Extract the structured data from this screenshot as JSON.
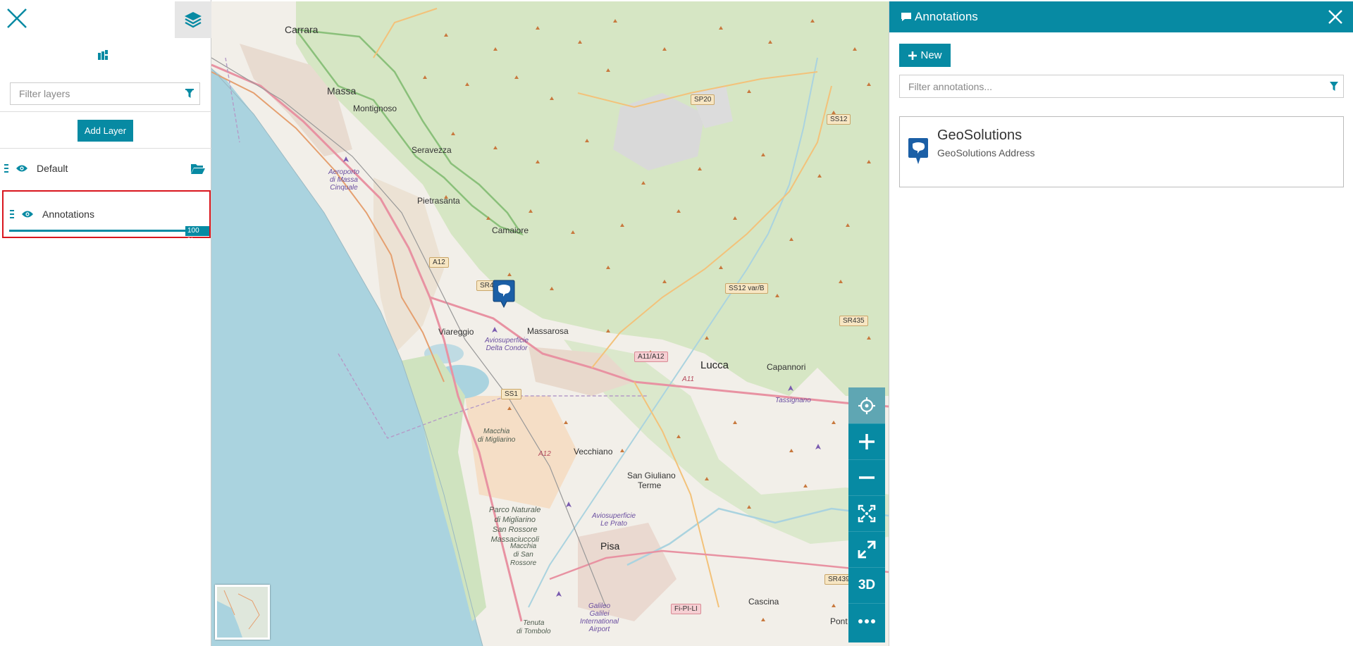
{
  "toc": {
    "filter_placeholder": "Filter layers",
    "add_layer_label": "Add Layer",
    "group_title": "Default",
    "layer_title": "Annotations",
    "opacity_label": "100 %",
    "opacity_value": 1.0
  },
  "map": {
    "places": {
      "carrara": "Carrara",
      "massa": "Massa",
      "montignoso": "Montignoso",
      "seravezza": "Seravezza",
      "pietrasanta": "Pietrasanta",
      "camaiore": "Camaiore",
      "viareggio": "Viareggio",
      "massarosa": "Massarosa",
      "lucca": "Lucca",
      "capannori": "Capannori",
      "vecchiano": "Vecchiano",
      "san_giuliano": "San Giuliano",
      "terme": "Terme",
      "pisa": "Pisa",
      "cascina": "Cascina",
      "pont": "Pont"
    },
    "italic_labels": {
      "aeroporto_1": "Aeroporto",
      "aeroporto_2": "di Massa",
      "aeroporto_3": "Cinquale",
      "avio_condor_1": "Aviosuperficie",
      "avio_condor_2": "Delta Condor",
      "tassignano": "Tassignano",
      "avio_prato_1": "Aviosuperficie",
      "avio_prato_2": "Le Prato",
      "galilei_1": "Galileo",
      "galilei_2": "Galilei",
      "galilei_3": "International",
      "galilei_4": "Airport",
      "macchia_1": "Macchia",
      "macchia_2": "di Migliarino",
      "parco_1": "Parco Naturale",
      "parco_2": "di Migliarino",
      "parco_3": "San Rossore",
      "parco_4": "Massaciuccoli",
      "macchia_sr_1": "Macchia",
      "macchia_sr_2": "di San",
      "macchia_sr_3": "Rossore",
      "tenuta_1": "Tenuta",
      "tenuta_2": "di Tombolo"
    },
    "roads": {
      "sp20": "SP20",
      "ss12": "SS12",
      "a12": "A12",
      "sr4": "SR4",
      "ss12varb": "SS12 var/B",
      "sr435": "SR435",
      "a11a12": "A11/A12",
      "a11": "A11",
      "ss1": "SS1",
      "a12b": "A12",
      "fipili": "Fi-PI-LI",
      "sr439": "SR439"
    },
    "tools": {
      "threed_label": "3D"
    }
  },
  "annotations": {
    "panel_title": "Annotations",
    "new_label": "New",
    "filter_placeholder": "Filter annotations...",
    "items": [
      {
        "title": "GeoSolutions",
        "description": "GeoSolutions Address"
      }
    ]
  },
  "colors": {
    "accent": "#078aa3",
    "highlight_border": "#d9161e",
    "sea": "#aad3df",
    "land": "#f2efe9",
    "forest": "#d3e4c2"
  }
}
